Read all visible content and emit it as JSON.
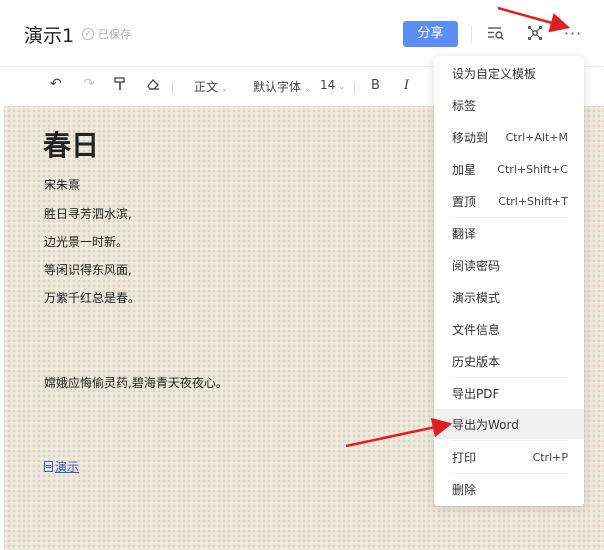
{
  "header": {
    "doc_title": "演示1",
    "saved_status": "已保存",
    "share_label": "分享"
  },
  "toolbar": {
    "style_label": "正文",
    "font_label": "默认字体",
    "size_label": "14",
    "bold_label": "B",
    "italic_label": "I"
  },
  "document": {
    "title": "春日",
    "author": "宋朱熹",
    "lines": [
      "胜日寻芳泗水滨,",
      "边光景一时新。",
      "等闲识得东风面,",
      "万紫千红总是春。"
    ],
    "extra_line": "嫦娥应悔偷灵药,碧海青天夜夜心。",
    "link_text": "演示"
  },
  "menu": {
    "items": [
      {
        "label": "设为自定义模板",
        "shortcut": ""
      },
      {
        "label": "标签",
        "shortcut": ""
      },
      {
        "label": "移动到",
        "shortcut": "Ctrl+Alt+M"
      },
      {
        "label": "加星",
        "shortcut": "Ctrl+Shift+C"
      },
      {
        "label": "置顶",
        "shortcut": "Ctrl+Shift+T"
      },
      {
        "label": "翻译",
        "shortcut": ""
      },
      {
        "label": "阅读密码",
        "shortcut": ""
      },
      {
        "label": "演示模式",
        "shortcut": ""
      },
      {
        "label": "文件信息",
        "shortcut": ""
      },
      {
        "label": "历史版本",
        "shortcut": ""
      },
      {
        "label": "导出PDF",
        "shortcut": ""
      },
      {
        "label": "导出为Word",
        "shortcut": ""
      },
      {
        "label": "打印",
        "shortcut": "Ctrl+P"
      },
      {
        "label": "删除",
        "shortcut": ""
      }
    ],
    "highlighted_item": "导出为Word"
  },
  "colors": {
    "accent": "#5b8ff5",
    "canvas_bg": "#ece5d8",
    "annotation_arrow": "#e02020",
    "link": "#3a5ec2"
  },
  "icons": {
    "undo": "undo-icon",
    "redo": "redo-icon",
    "format_painter": "format-painter-icon",
    "eraser": "eraser-icon",
    "outline": "outline-search-icon",
    "mind_map": "mind-map-icon",
    "more": "more-icon"
  }
}
